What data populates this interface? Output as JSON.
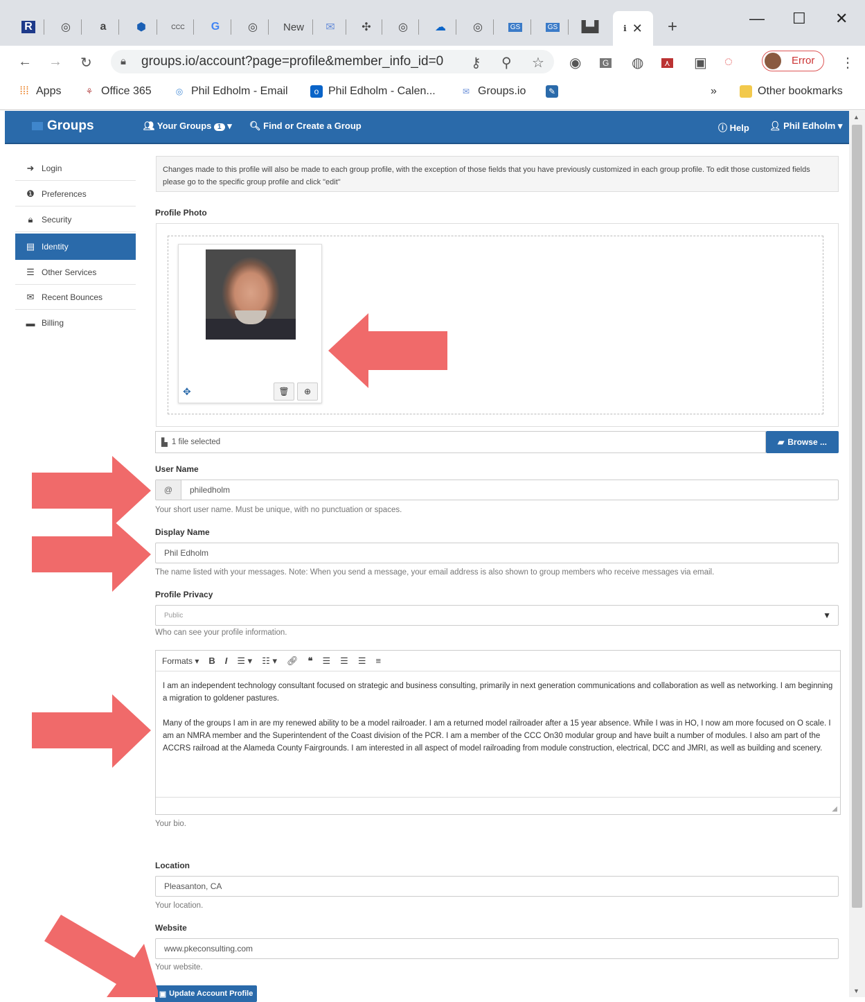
{
  "browser": {
    "url": "groups.io/account?page=profile&member_info_id=0",
    "new_tab_label": "New",
    "profile_error": "Error",
    "bookmarks": {
      "apps": "Apps",
      "office": "Office 365",
      "email": "Phil Edholm - Email",
      "calendar": "Phil Edholm - Calen...",
      "groups": "Groups.io",
      "more": "»",
      "other": "Other bookmarks"
    }
  },
  "nav": {
    "brand": "Groups",
    "your_groups": "Your Groups",
    "your_groups_count": "1",
    "find": "Find or Create a Group",
    "help": "Help",
    "user": "Phil Edholm"
  },
  "sidebar": {
    "items": [
      {
        "label": "Login"
      },
      {
        "label": "Preferences"
      },
      {
        "label": "Security"
      },
      {
        "label": "Identity"
      },
      {
        "label": "Other Services"
      },
      {
        "label": "Recent Bounces"
      },
      {
        "label": "Billing"
      }
    ]
  },
  "notice": "Changes made to this profile will also be made to each group profile, with the exception of those fields that you have previously customized in each group profile. To edit those customized fields please go to the specific group profile and click \"edit\"",
  "photo": {
    "label": "Profile Photo",
    "file_status": "1 file selected",
    "browse": "Browse ..."
  },
  "username": {
    "label": "User Name",
    "prefix": "@",
    "value": "philedholm",
    "help": "Your short user name. Must be unique, with no punctuation or spaces."
  },
  "display_name": {
    "label": "Display Name",
    "value": "Phil Edholm",
    "help": "The name listed with your messages. Note: When you send a message, your email address is also shown to group members who receive messages via email."
  },
  "privacy": {
    "label": "Profile Privacy",
    "value": "Public",
    "help": "Who can see your profile information."
  },
  "bio": {
    "formats": "Formats",
    "p1": "I am an independent technology consultant focused on strategic and business consulting, primarily in next generation communications and collaboration as well as networking. I am beginning a migration to goldener pastures.",
    "p2": "Many of the groups I am in are my renewed ability to be a model railroader. I am a returned model railroader after a 15 year absence. While I was in HO, I now am more focused on O scale. I am an NMRA member and the Superintendent of the Coast division of the PCR. I am a member of the CCC On30 modular group and have built a number of modules. I also am part of the ACCRS railroad at the Alameda County Fairgrounds. I am interested in all aspect of model railroading from module construction, electrical, DCC and JMRI, as well as building and scenery.",
    "help": "Your bio."
  },
  "location": {
    "label": "Location",
    "value": "Pleasanton, CA",
    "help": "Your location."
  },
  "website": {
    "label": "Website",
    "value": "www.pkeconsulting.com",
    "help": "Your website."
  },
  "submit": "Update Account Profile",
  "colors": {
    "nav": "#2a6aaa",
    "arrow": "#f06a6a"
  }
}
